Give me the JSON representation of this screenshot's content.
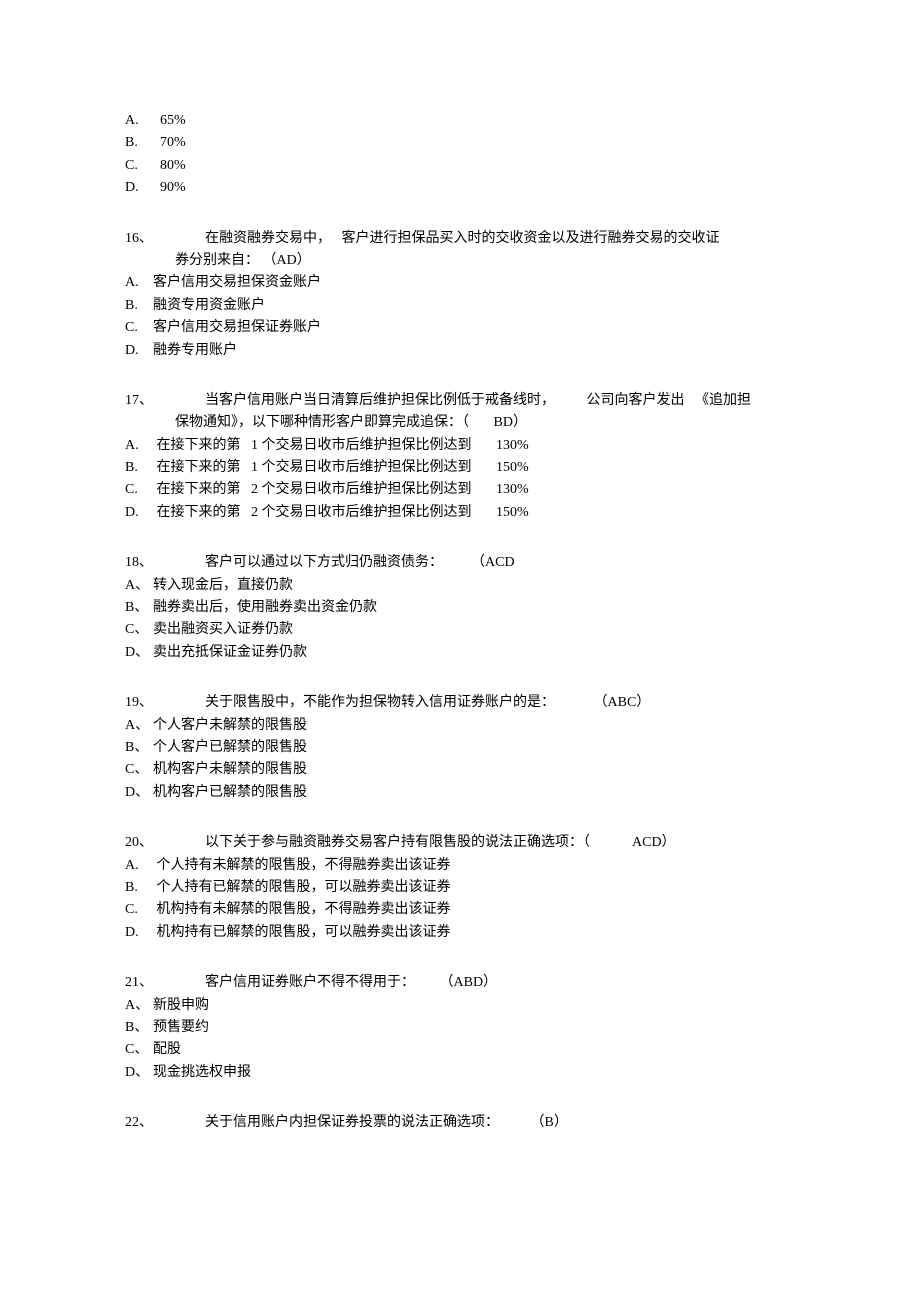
{
  "q15": {
    "A": {
      "label": "A.",
      "text": "  65%"
    },
    "B": {
      "label": "B.",
      "text": "  70%"
    },
    "C": {
      "label": "C.",
      "text": "  80%"
    },
    "D": {
      "label": "D.",
      "text": "  90%"
    }
  },
  "q16": {
    "num": "16、",
    "stem": "在融资融券交易中，   客户进行担保品买入时的交收资金以及进行融券交易的交收证",
    "cont": "券分别来自： （AD）",
    "A": {
      "label": "A.",
      "text": "客户信用交易担保资金账户"
    },
    "B": {
      "label": "B.",
      "text": "融资专用资金账户"
    },
    "C": {
      "label": "C.",
      "text": "客户信用交易担保证券账户"
    },
    "D": {
      "label": "D.",
      "text": "融券专用账户"
    }
  },
  "q17": {
    "num": "17、",
    "stem": "当客户信用账户当日清算后维护担保比例低于戒备线时，         公司向客户发出   《追加担",
    "cont": "保物通知》，以下哪种情形客户即算完成追保：（       BD）",
    "A": {
      "label": "A.",
      "text": " 在接下来的第   1 个交易日收市后维护担保比例达到       130%"
    },
    "B": {
      "label": "B.",
      "text": " 在接下来的第   1 个交易日收市后维护担保比例达到       150%"
    },
    "C": {
      "label": "C.",
      "text": " 在接下来的第   2 个交易日收市后维护担保比例达到       130%"
    },
    "D": {
      "label": "D.",
      "text": " 在接下来的第   2 个交易日收市后维护担保比例达到       150%"
    }
  },
  "q18": {
    "num": "18、",
    "stem": "客户可以通过以下方式归仍融资债务：        （ACD",
    "A": {
      "label": "A、",
      "text": "转入现金后，直接仍款"
    },
    "B": {
      "label": "B、",
      "text": "融券卖出后，使用融券卖出资金仍款"
    },
    "C": {
      "label": "C、",
      "text": "卖出融资买入证券仍款"
    },
    "D": {
      "label": "D、",
      "text": "卖出充抵保证金证券仍款"
    }
  },
  "q19": {
    "num": "19、",
    "stem": "关于限售股中，不能作为担保物转入信用证券账户的是：           （ABC）",
    "A": {
      "label": "A、",
      "text": "个人客户未解禁的限售股"
    },
    "B": {
      "label": "B、",
      "text": "个人客户已解禁的限售股"
    },
    "C": {
      "label": "C、",
      "text": "机构客户未解禁的限售股"
    },
    "D": {
      "label": "D、",
      "text": "机构客户已解禁的限售股"
    }
  },
  "q20": {
    "num": "20、",
    "stem": "以下关于参与融资融券交易客户持有限售股的说法正确选项：（            ACD）",
    "A": {
      "label": "A.",
      "text": " 个人持有未解禁的限售股，不得融券卖出该证券"
    },
    "B": {
      "label": "B.",
      "text": " 个人持有已解禁的限售股，可以融券卖出该证券"
    },
    "C": {
      "label": "C.",
      "text": " 机构持有未解禁的限售股，不得融券卖出该证券"
    },
    "D": {
      "label": "D.",
      "text": " 机构持有已解禁的限售股，可以融券卖出该证券"
    }
  },
  "q21": {
    "num": "21、",
    "stem": "客户信用证券账户不得不得用于：       （ABD）",
    "A": {
      "label": "A、",
      "text": "新股申购"
    },
    "B": {
      "label": "B、",
      "text": "预售要约"
    },
    "C": {
      "label": "C、",
      "text": "配股"
    },
    "D": {
      "label": "D、",
      "text": "现金挑选权申报"
    }
  },
  "q22": {
    "num": "22、",
    "stem": "关于信用账户内担保证券投票的说法正确选项：         （B）"
  }
}
